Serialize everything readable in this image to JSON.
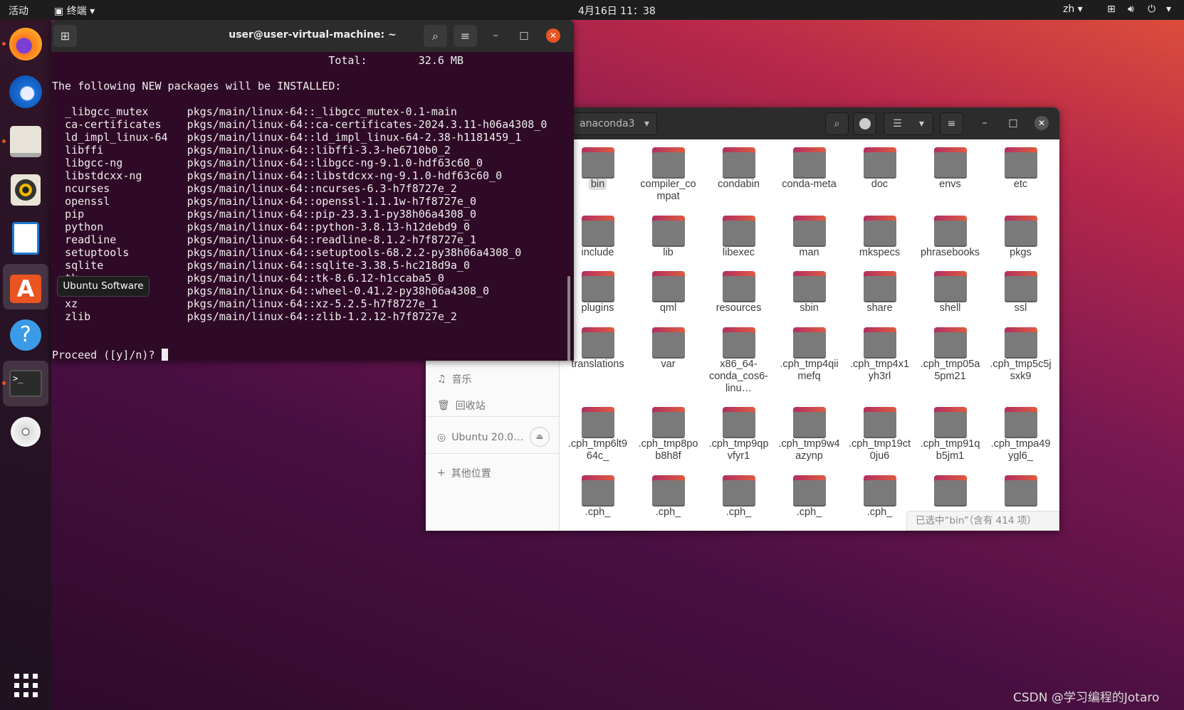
{
  "topbar": {
    "activities": "活动",
    "app_menu": "终端",
    "clock": "4月16日 11：38",
    "lang": "zh"
  },
  "dock": {
    "tooltip": "Ubuntu Software",
    "items": [
      "firefox",
      "thunderbird",
      "files",
      "rhythmbox",
      "libreoffice-writer",
      "ubuntu-software",
      "help",
      "terminal",
      "dvd",
      "show-applications"
    ]
  },
  "terminal": {
    "title": "user@user-virtual-machine: ~",
    "total_label": "Total:",
    "total_value": "32.6 MB",
    "heading": "The following NEW packages will be INSTALLED:",
    "packages": [
      [
        "_libgcc_mutex",
        "pkgs/main/linux-64::_libgcc_mutex-0.1-main"
      ],
      [
        "ca-certificates",
        "pkgs/main/linux-64::ca-certificates-2024.3.11-h06a4308_0"
      ],
      [
        "ld_impl_linux-64",
        "pkgs/main/linux-64::ld_impl_linux-64-2.38-h1181459_1"
      ],
      [
        "libffi",
        "pkgs/main/linux-64::libffi-3.3-he6710b0_2"
      ],
      [
        "libgcc-ng",
        "pkgs/main/linux-64::libgcc-ng-9.1.0-hdf63c60_0"
      ],
      [
        "libstdcxx-ng",
        "pkgs/main/linux-64::libstdcxx-ng-9.1.0-hdf63c60_0"
      ],
      [
        "ncurses",
        "pkgs/main/linux-64::ncurses-6.3-h7f8727e_2"
      ],
      [
        "openssl",
        "pkgs/main/linux-64::openssl-1.1.1w-h7f8727e_0"
      ],
      [
        "pip",
        "pkgs/main/linux-64::pip-23.3.1-py38h06a4308_0"
      ],
      [
        "python",
        "pkgs/main/linux-64::python-3.8.13-h12debd9_0"
      ],
      [
        "readline",
        "pkgs/main/linux-64::readline-8.1.2-h7f8727e_1"
      ],
      [
        "setuptools",
        "pkgs/main/linux-64::setuptools-68.2.2-py38h06a4308_0"
      ],
      [
        "sqlite",
        "pkgs/main/linux-64::sqlite-3.38.5-hc218d9a_0"
      ],
      [
        "tk",
        "pkgs/main/linux-64::tk-8.6.12-h1ccaba5_0"
      ],
      [
        "wheel",
        "pkgs/main/linux-64::wheel-0.41.2-py38h06a4308_0"
      ],
      [
        "xz",
        "pkgs/main/linux-64::xz-5.2.5-h7f8727e_1"
      ],
      [
        "zlib",
        "pkgs/main/linux-64::zlib-1.2.12-h7f8727e_2"
      ]
    ],
    "prompt": "Proceed ([y]/n)? "
  },
  "files": {
    "path": "anaconda3",
    "sidebar": {
      "music": "音乐",
      "trash": "回收站",
      "device": "Ubuntu 20.0…",
      "other": "其他位置"
    },
    "items": [
      "bin",
      "compiler_compat",
      "condabin",
      "conda-meta",
      "doc",
      "envs",
      "etc",
      "include",
      "lib",
      "libexec",
      "man",
      "mkspecs",
      "phrasebooks",
      "pkgs",
      "plugins",
      "qml",
      "resources",
      "sbin",
      "share",
      "shell",
      "ssl",
      "translations",
      "var",
      "x86_64-conda_cos6-linu…",
      ".cph_tmp4qiimefq",
      ".cph_tmp4x1yh3rl",
      ".cph_tmp05a5pm21",
      ".cph_tmp5c5jsxk9",
      ".cph_tmp6lt964c_",
      ".cph_tmp8pob8h8f",
      ".cph_tmp9qpvfyr1",
      ".cph_tmp9w4azynp",
      ".cph_tmp19ct0ju6",
      ".cph_tmp91qb5jm1",
      ".cph_tmpa49ygl6_",
      ".cph_",
      ".cph_",
      ".cph_",
      ".cph_",
      ".cph_",
      "",
      ""
    ],
    "selected": "bin",
    "status": "已选中“bin”（含有 414 项）"
  },
  "watermark": "CSDN @学习编程的Jotaro",
  "colors": {
    "accent": "#e95420",
    "terminal_bg": "#2f0a26"
  }
}
